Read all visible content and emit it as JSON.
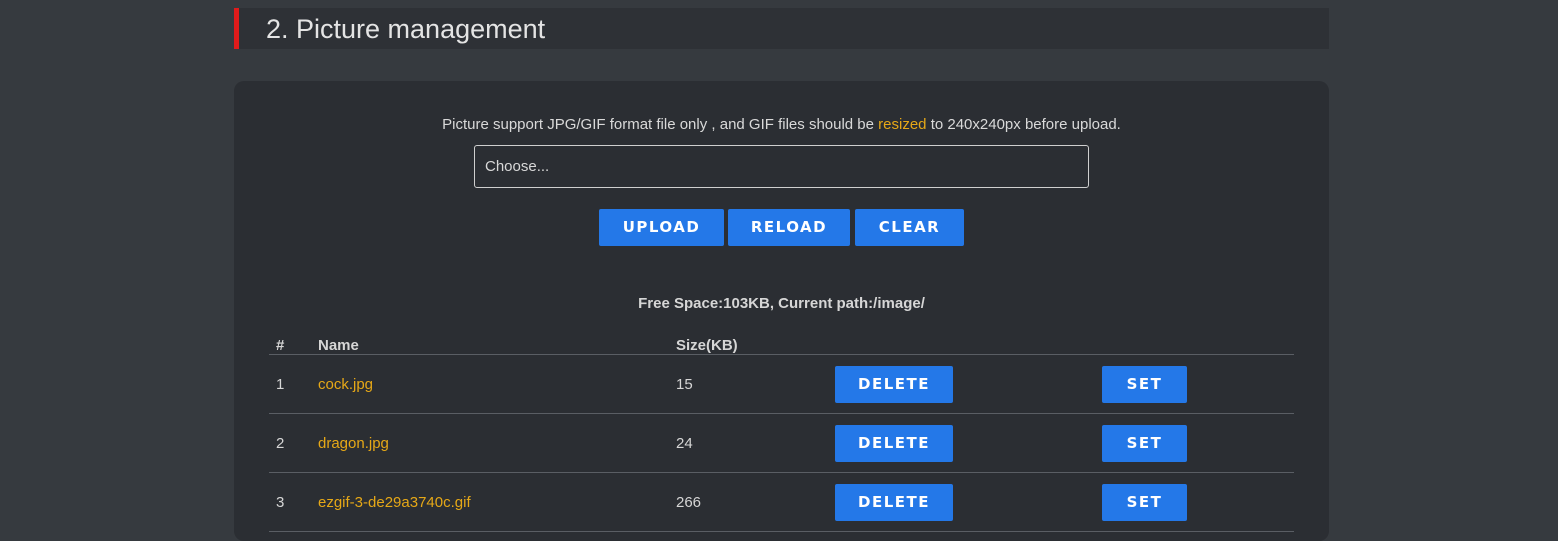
{
  "section": {
    "title": "2. Picture management",
    "accent_color": "#e01b1b"
  },
  "upload": {
    "note_prefix": "Picture support JPG/GIF format file only , and GIF files should be ",
    "note_highlight": "resized",
    "note_suffix": " to 240x240px before upload.",
    "file_placeholder": "Choose...",
    "upload_label": "UPLOAD",
    "reload_label": "RELOAD",
    "clear_label": "CLEAR"
  },
  "storage": {
    "info": "Free Space:103KB, Current path:/image/"
  },
  "table": {
    "headers": {
      "num": "#",
      "name": "Name",
      "size": "Size(KB)"
    },
    "rows": [
      {
        "num": "1",
        "name": "cock.jpg",
        "size": "15",
        "delete_label": "DELETE",
        "set_label": "SET"
      },
      {
        "num": "2",
        "name": "dragon.jpg",
        "size": "24",
        "delete_label": "DELETE",
        "set_label": "SET"
      },
      {
        "num": "3",
        "name": "ezgif-3-de29a3740c.gif",
        "size": "266",
        "delete_label": "DELETE",
        "set_label": "SET"
      }
    ]
  },
  "colors": {
    "background": "#363a3f",
    "panel": "#2b2e33",
    "button": "#2478e8",
    "link": "#e6a817"
  }
}
